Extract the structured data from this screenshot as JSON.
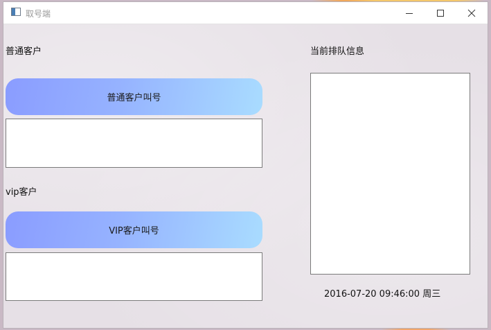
{
  "window": {
    "title": "取号端"
  },
  "normal_customer": {
    "section_label": "普通客户",
    "call_button_label": "普通客户叫号",
    "display_value": ""
  },
  "vip_customer": {
    "section_label": "vip客户",
    "call_button_label": "VIP客户叫号",
    "display_value": ""
  },
  "queue": {
    "label": "当前排队信息",
    "content": ""
  },
  "status": {
    "datetime": "2016-07-20 09:46:00 周三"
  },
  "icons": {
    "app": "app-icon",
    "minimize": "minimize-icon",
    "maximize": "maximize-icon",
    "close": "close-icon"
  }
}
